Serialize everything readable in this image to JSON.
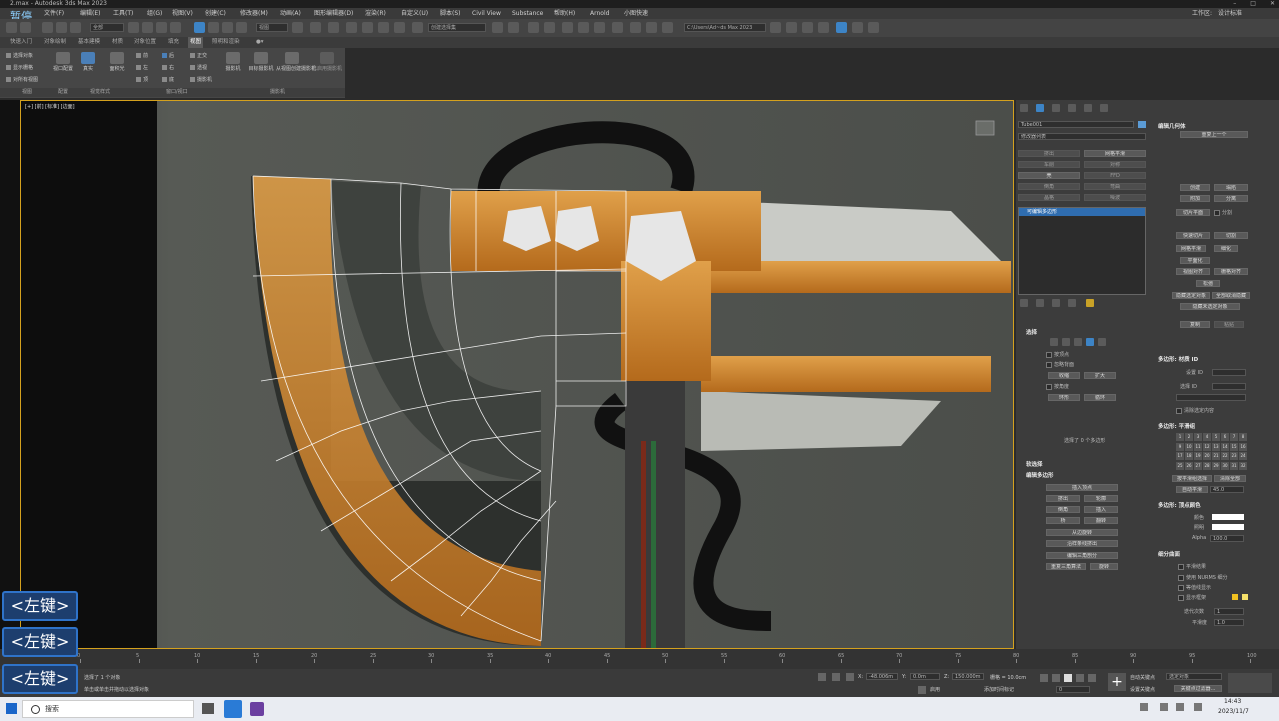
{
  "window": {
    "title": "2.max - Autodesk 3ds Max 2023",
    "pause_label": "暂停"
  },
  "menu": [
    "文件(F)",
    "编辑(E)",
    "工具(T)",
    "组(G)",
    "视图(V)",
    "创建(C)",
    "修改器(M)",
    "动画(A)",
    "图形编辑器(D)",
    "渲染(R)",
    "自定义(U)",
    "脚本(S)",
    "Civil View",
    "Substance",
    "帮助(H)",
    "Arnold",
    "小图快速"
  ],
  "workspace": {
    "label": "工作区:",
    "value": "设计标准"
  },
  "toolbar": {
    "selection_filter": "全部",
    "view_coord": "视图",
    "selection_set": "创建选择集",
    "path": "C:\\Users\\Ad~ds Max 2023"
  },
  "ribbon_tabs": [
    "快速入门",
    "对象绘制",
    "基本建模",
    "材质",
    "对象位置",
    "填充",
    "视图",
    "照明和渲染"
  ],
  "ribbon_active_tab": "视图",
  "ribbon": {
    "tools": [
      "视口配置",
      "真实",
      "面积光",
      "摄影机",
      "目标摄影机",
      "从视图创建摄影机",
      "已启用摄影机"
    ],
    "small_items": [
      "选择对象",
      "显示栅格",
      "对所有视图",
      "前",
      "左",
      "顶",
      "后",
      "右",
      "底",
      "正交",
      "透视",
      "摄影机"
    ],
    "group_labels": [
      "视图",
      "配置",
      "视觉样式",
      "窗口/视口",
      "摄影机"
    ]
  },
  "viewport": {
    "label": "[+] [前] [标准] [边面]"
  },
  "command_panel": {
    "object_name": "Tube001",
    "modifier_list": "修改器列表",
    "mod_buttons": [
      "挤出",
      "网格平滑",
      "车削",
      "对称",
      "壳",
      "FFD",
      "倒角",
      "弯曲",
      "晶格",
      "噪波"
    ],
    "stack_item": "可编辑多边形",
    "sections": {
      "selection": "选择",
      "soft_selection": "软选择",
      "edit_polygons": "编辑多边形",
      "edit_geometry": "编辑几何体",
      "poly_material_ids": "多边形: 材质 ID",
      "smoothing_groups": "多边形: 平滑组",
      "vertex_colors": "多边形: 顶点颜色",
      "subdivision": "细分曲面"
    },
    "selection_items": [
      "按顶点",
      "忽略背面",
      "按角度",
      "收缩",
      "扩大",
      "环形",
      "循环"
    ],
    "selection_status": "选择了 0 个多边形",
    "edit_poly_buttons": [
      "插入顶点",
      "挤出",
      "轮廓",
      "倒角",
      "插入",
      "桥",
      "翻转",
      "从边旋转",
      "沿样条线挤出",
      "编辑三角剖分",
      "重复三角算法",
      "旋转"
    ],
    "edit_geom_buttons": [
      "重复上一个",
      "创建",
      "塌陷",
      "附加",
      "分离",
      "切片平面",
      "分割",
      "快速切片",
      "切割",
      "网格平滑",
      "细化",
      "平面化",
      "视图对齐",
      "栅格对齐",
      "松弛",
      "隐藏选定对象",
      "全部取消隐藏",
      "隐藏未选定对象",
      "复制",
      "粘贴"
    ],
    "material_id": {
      "set_label": "设置 ID",
      "select_label": "选择 ID",
      "clear_label": "清除选定内容"
    },
    "smoothing_numbers": [
      "1",
      "2",
      "3",
      "4",
      "5",
      "6",
      "7",
      "8",
      "9",
      "10",
      "11",
      "12",
      "13",
      "14",
      "15",
      "16",
      "17",
      "18",
      "19",
      "20",
      "21",
      "22",
      "23",
      "24",
      "25",
      "26",
      "27",
      "28",
      "29",
      "30",
      "31",
      "32"
    ],
    "smoothing_buttons": [
      "按平滑组选择",
      "清除全部",
      "自动平滑",
      "45.0"
    ],
    "vertex_color": {
      "color_label": "颜色",
      "illum_label": "照明",
      "alpha_label": "Alpha",
      "alpha_value": "100.0"
    },
    "subdiv_items": [
      "平滑结果",
      "使用 NURMS 细分",
      "等值线显示",
      "显示框架",
      "迭代次数",
      "平滑度"
    ],
    "iterations": "1",
    "smoothness": "1.0"
  },
  "timeline": {
    "ticks": [
      "0",
      "5",
      "10",
      "15",
      "20",
      "25",
      "30",
      "35",
      "40",
      "45",
      "50",
      "55",
      "60",
      "65",
      "70",
      "75",
      "80",
      "85",
      "90",
      "95",
      "100"
    ]
  },
  "status": {
    "selected": "选择了 1 个对象",
    "hint": "单击或单击并拖动以选择对象",
    "x_label": "X:",
    "x_value": "-48.006m",
    "y_label": "Y:",
    "y_value": "0.0m",
    "z_label": "Z:",
    "z_value": "150.000m",
    "grid": "栅格 = 10.0cm",
    "enabled": "启用",
    "add_time_tag": "添加时间标记",
    "auto_key": "自动关键点",
    "selected_obj": "选定对象",
    "set_key": "设置关键点",
    "key_filter": "关键点过滤器...",
    "frame": "0"
  },
  "taskbar": {
    "search": "搜索",
    "time": "14:43",
    "date": "2023/11/7"
  },
  "key_overlays": [
    "<左键>",
    "<左键>",
    "<左键>"
  ]
}
